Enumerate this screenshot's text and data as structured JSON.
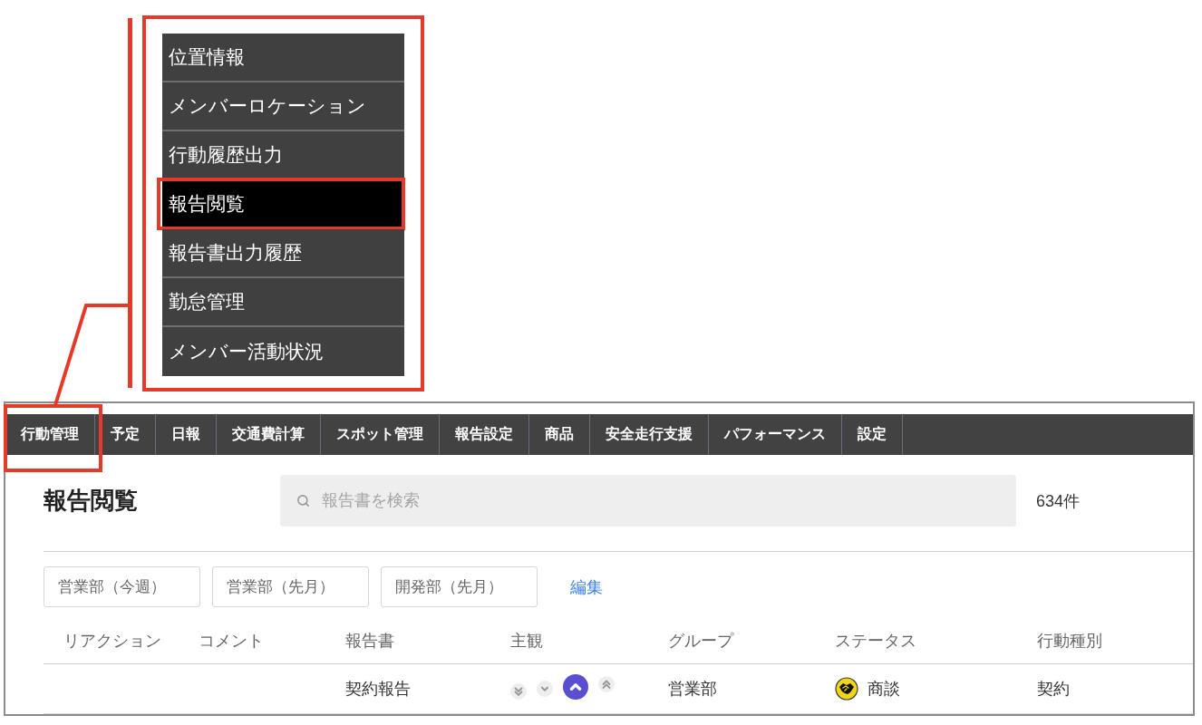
{
  "menu": {
    "items": [
      {
        "label": "位置情報",
        "selected": false
      },
      {
        "label": "メンバーロケーション",
        "selected": false
      },
      {
        "label": "行動履歴出力",
        "selected": false
      },
      {
        "label": "報告閲覧",
        "selected": true
      },
      {
        "label": "報告書出力履歴",
        "selected": false
      },
      {
        "label": "勤怠管理",
        "selected": false
      },
      {
        "label": "メンバー活動状況",
        "selected": false
      }
    ]
  },
  "nav_tabs": [
    {
      "label": "行動管理",
      "highlighted": true
    },
    {
      "label": "予定",
      "highlighted": false
    },
    {
      "label": "日報",
      "highlighted": false
    },
    {
      "label": "交通費計算",
      "highlighted": false
    },
    {
      "label": "スポット管理",
      "highlighted": false
    },
    {
      "label": "報告設定",
      "highlighted": false
    },
    {
      "label": "商品",
      "highlighted": false
    },
    {
      "label": "安全走行支援",
      "highlighted": false
    },
    {
      "label": "パフォーマンス",
      "highlighted": false
    },
    {
      "label": "設定",
      "highlighted": false
    }
  ],
  "page": {
    "title": "報告閲覧",
    "search": {
      "placeholder": "報告書を検索"
    },
    "count": "634件"
  },
  "filters": {
    "chips": [
      "営業部（今週）",
      "営業部（先月）",
      "開発部（先月）"
    ],
    "edit_link": "編集"
  },
  "table": {
    "columns": [
      "リアクション",
      "コメント",
      "報告書",
      "主観",
      "グループ",
      "ステータス",
      "行動種別"
    ],
    "rows": [
      {
        "report": "契約報告",
        "subjective": [
          {
            "kind": "double-down",
            "selected": false
          },
          {
            "kind": "down",
            "selected": false
          },
          {
            "kind": "up",
            "selected": true
          },
          {
            "kind": "double-up",
            "selected": false
          }
        ],
        "group": "営業部",
        "status": {
          "label": "商談"
        },
        "action_type": "契約"
      }
    ]
  }
}
